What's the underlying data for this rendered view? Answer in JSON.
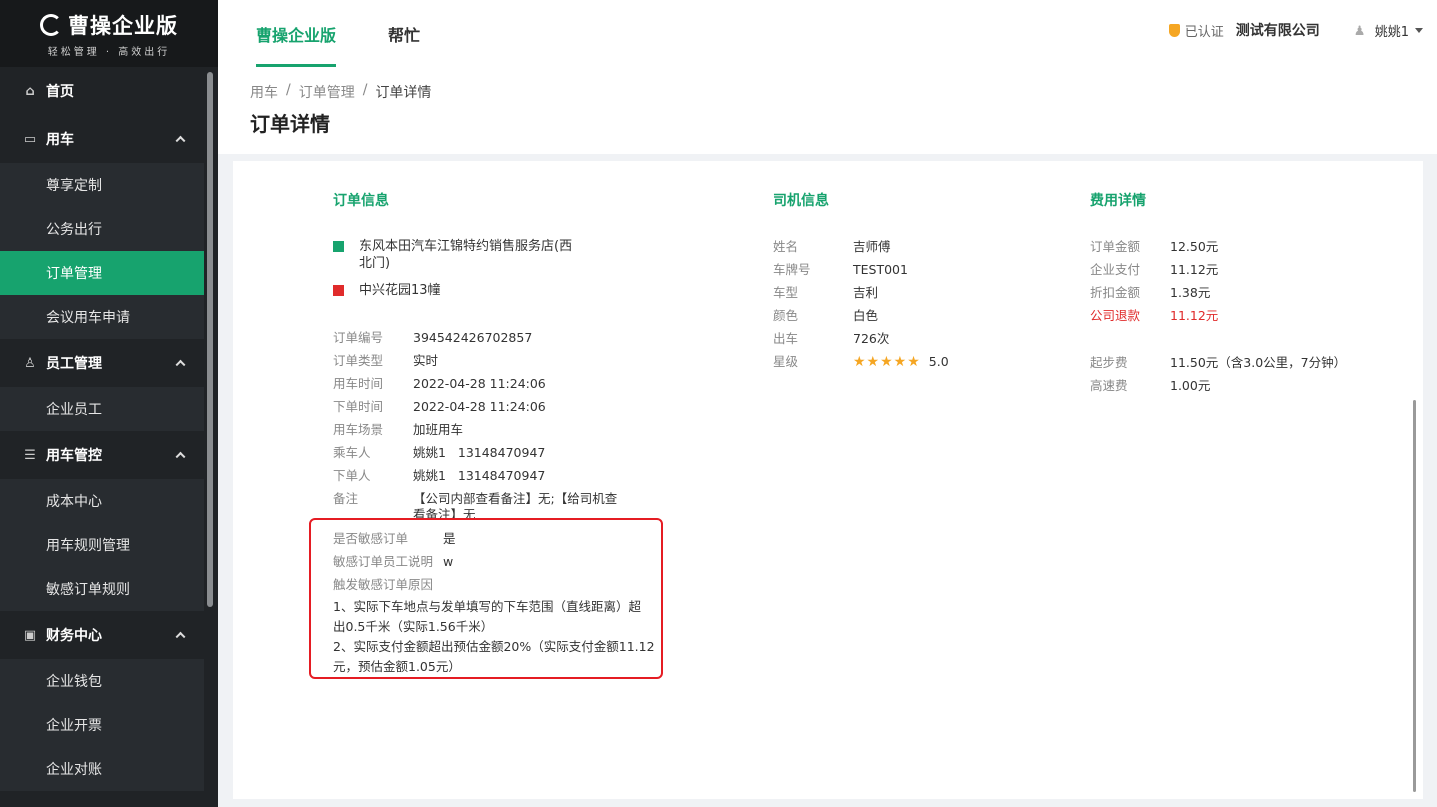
{
  "logo": {
    "title": "曹操企业版",
    "subtitle": "轻松管理 · 高效出行"
  },
  "sidebar": {
    "groups": [
      {
        "label": "首页",
        "icon": "home-icon"
      },
      {
        "label": "用车",
        "icon": "car-icon",
        "items": [
          "尊享定制",
          "公务出行",
          "订单管理",
          "会议用车申请"
        ]
      },
      {
        "label": "员工管理",
        "icon": "user-icon",
        "items": [
          "企业员工"
        ]
      },
      {
        "label": "用车管控",
        "icon": "sliders-icon",
        "items": [
          "成本中心",
          "用车规则管理",
          "敏感订单规则"
        ]
      },
      {
        "label": "财务中心",
        "icon": "wallet-icon",
        "items": [
          "企业钱包",
          "企业开票",
          "企业对账"
        ]
      }
    ],
    "active_item": "订单管理"
  },
  "topnav": {
    "tab_active": "曹操企业版",
    "tab_help": "帮忙"
  },
  "account": {
    "verified": "已认证",
    "company": "测试有限公司",
    "user": "姚姚1"
  },
  "breadcrumb": {
    "b1": "用车",
    "b2": "订单管理",
    "b3": "订单详情",
    "sep": "/"
  },
  "page_title": "订单详情",
  "order": {
    "title": "订单信息",
    "start": "东风本田汽车江锦特约销售服务店(西北门)",
    "start_l1": "东风本田汽车江锦特约销售服务店(西",
    "start_l2": "北门)",
    "end": "中兴花园13幢",
    "fields": [
      {
        "k": "订单编号",
        "v": "394542426702857"
      },
      {
        "k": "订单类型",
        "v": "实时"
      },
      {
        "k": "用车时间",
        "v": "2022-04-28 11:24:06"
      },
      {
        "k": "下单时间",
        "v": "2022-04-28 11:24:06"
      },
      {
        "k": "用车场景",
        "v": "加班用车"
      },
      {
        "k": "乘车人",
        "v": "姚姚1   13148470947"
      },
      {
        "k": "下单人",
        "v": "姚姚1   13148470947"
      },
      {
        "k": "备注",
        "v": "【公司内部查看备注】无;【给司机查"
      }
    ],
    "remark_l2": "看备注】无",
    "sensitive": {
      "k": "是否敏感订单",
      "v": "是"
    },
    "explain": {
      "k": "敏感订单员工说明",
      "v": "w"
    },
    "reason_title": "触发敏感订单原因",
    "reason1_l1": "1、实际下车地点与发单填写的下车范围（直线距离）超",
    "reason1_l2": "出0.5千米（实际1.56千米）",
    "reason2_l1": "2、实际支付金额超出预估金额20%（实际支付金额11.12",
    "reason2_l2": "元，预估金额1.05元）"
  },
  "driver": {
    "title": "司机信息",
    "fields": [
      {
        "k": "姓名",
        "v": "吉师傅"
      },
      {
        "k": "车牌号",
        "v": "TEST001"
      },
      {
        "k": "车型",
        "v": "吉利"
      },
      {
        "k": "颜色",
        "v": "白色"
      },
      {
        "k": "出车",
        "v": "726次"
      }
    ],
    "rating_label": "星级",
    "rating_stars": "★★★★★",
    "rating": "5.0"
  },
  "fee": {
    "title": "费用详情",
    "fields": [
      {
        "k": "订单金额",
        "v": "12.50元"
      },
      {
        "k": "企业支付",
        "v": "11.12元"
      },
      {
        "k": "折扣金额",
        "v": "1.38元"
      },
      {
        "k": "公司退款",
        "v": "11.12元"
      }
    ],
    "fields2": [
      {
        "k": "起步费",
        "v": "11.50元（含3.0公里，7分钟）"
      },
      {
        "k": "高速费",
        "v": "1.00元"
      }
    ]
  },
  "colors": {
    "accent": "#17a36e",
    "start_marker": "#17a36e",
    "end_marker": "#e02b2b",
    "refund": "#e02b2b",
    "highlight_box": "#e51c23"
  }
}
